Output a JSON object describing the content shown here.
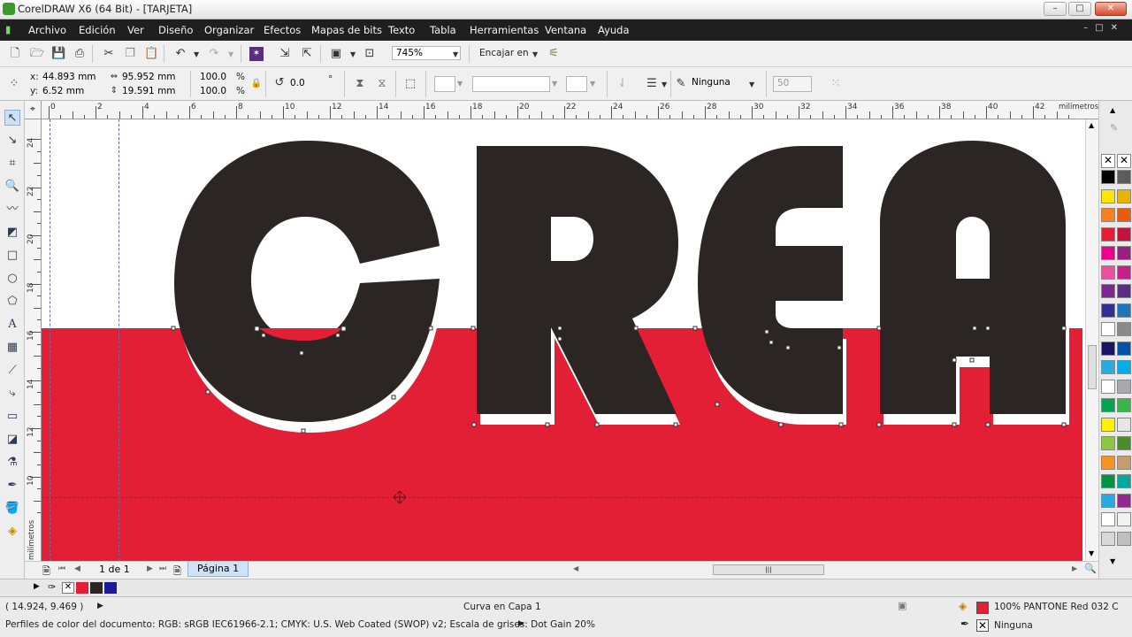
{
  "window": {
    "title": "CorelDRAW X6 (64 Bit) - [TARJETA]",
    "controls": [
      "–",
      "□",
      "✕"
    ]
  },
  "menu": [
    "Archivo",
    "Edición",
    "Ver",
    "Diseño",
    "Organizar",
    "Efectos",
    "Mapas de bits",
    "Texto",
    "Tabla",
    "Herramientas",
    "Ventana",
    "Ayuda"
  ],
  "toolbar": {
    "zoom": "745%",
    "snap_label": "Encajar en"
  },
  "properties": {
    "x": "44.893 mm",
    "y": "6.52 mm",
    "width": "95.952 mm",
    "height": "19.591 mm",
    "scale_x": "100.0",
    "scale_y": "100.0",
    "pct": "%",
    "rotation": "0.0",
    "degree": "°",
    "outline": "Ninguna",
    "value50": "50"
  },
  "ruler": {
    "unit": "milímetros",
    "h_labels": [
      "0",
      "2",
      "4",
      "6",
      "8",
      "10",
      "12",
      "14",
      "16",
      "18",
      "20",
      "22",
      "24",
      "26",
      "28",
      "30",
      "32",
      "34",
      "36",
      "38",
      "40",
      "42"
    ],
    "v_labels": [
      "24",
      "22",
      "20",
      "18",
      "16",
      "14",
      "12",
      "10"
    ]
  },
  "artwork": {
    "text": "CREA",
    "letter_color": "#2b2623",
    "background_color": "#e21f35"
  },
  "navigation": {
    "page_count": "1 de 1",
    "page_tab": "Página 1"
  },
  "palette": {
    "colors": [
      "#000000",
      "#5c5c5c",
      "#ffe600",
      "#e8b400",
      "#f5821f",
      "#e85d0c",
      "#e21f35",
      "#c0143c",
      "#ec008c",
      "#9b1e83",
      "#ec4f9c",
      "#c6208a",
      "#7a2a8f",
      "#5b2d83",
      "#2e3192",
      "#1b75bc",
      "#ffffff",
      "#8a8a8a",
      "#1b1464",
      "#0054a6",
      "#29abe2",
      "#00aeef",
      "#ffffff",
      "#a7a9ac",
      "#00a651",
      "#39b54a",
      "#fff200",
      "#e6e6e6",
      "#8dc63f",
      "#4d8c2a",
      "#f7941d",
      "#c69c6d",
      "#009444",
      "#00a99d",
      "#27aae1",
      "#92278f",
      "#ffffff",
      "#f2f2f2",
      "#d9d9d9",
      "#bfbfbf"
    ]
  },
  "status": {
    "coords": "( 14.924, 9.469  )",
    "object": "Curva en Capa 1",
    "color_profile": "Perfiles de color del documento: RGB: sRGB IEC61966-2.1; CMYK: U.S. Web Coated (SWOP) v2; Escala de grises: Dot Gain 20%",
    "fill": "100% PANTONE Red 032 C",
    "outline": "Ninguna",
    "fill_color": "#e21f35"
  }
}
